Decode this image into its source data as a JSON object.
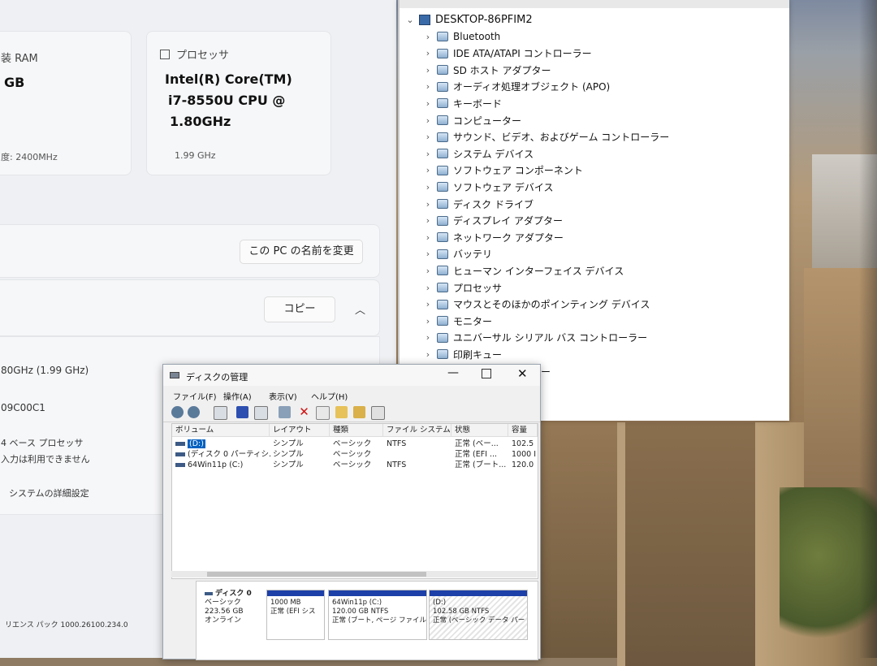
{
  "settings": {
    "ram_label_partial": "装 RAM",
    "ram_value_partial": "GB",
    "ram_speed_partial": "度: 2400MHz",
    "processor_label": "プロセッサ",
    "processor_line1": "Intel(R) Core(TM)",
    "processor_line2": "i7-8550U CPU @",
    "processor_line3": "1.80GHz",
    "processor_speed": "1.99 GHz",
    "rename_button": "この PC の名前を変更",
    "copy_button": "コピー",
    "spec_rows": [
      "80GHz (1.99 GHz)",
      "09C00C1",
      "4 ベース プロセッサ",
      "入力は利用できません"
    ],
    "advanced_link": "システムの詳細設定",
    "experience_pack": "リエンス パック 1000.26100.234.0"
  },
  "device_manager": {
    "root": "DESKTOP-86PFIM2",
    "items": [
      "Bluetooth",
      "IDE ATA/ATAPI コントローラー",
      "SD ホスト アダプター",
      "オーディオ処理オブジェクト (APO)",
      "キーボード",
      "コンピューター",
      "サウンド、ビデオ、およびゲーム コントローラー",
      "システム デバイス",
      "ソフトウェア コンポーネント",
      "ソフトウェア デバイス",
      "ディスク ドライブ",
      "ディスプレイ アダプター",
      "ネットワーク アダプター",
      "バッテリ",
      "ヒューマン インターフェイス デバイス",
      "プロセッサ",
      "マウスとそのほかのポインティング デバイス",
      "モニター",
      "ユニバーサル シリアル バス コントローラー",
      "印刷キュー",
      "記憶域コントローラー"
    ]
  },
  "disk_management": {
    "title": "ディスクの管理",
    "menu": [
      "ファイル(F)",
      "操作(A)",
      "表示(V)",
      "ヘルプ(H)"
    ],
    "columns": [
      "ボリューム",
      "レイアウト",
      "種類",
      "ファイル システム",
      "状態",
      "容量"
    ],
    "rows": [
      [
        "(D:)",
        "シンプル",
        "ベーシック",
        "NTFS",
        "正常 (ベー...",
        "102.5"
      ],
      [
        "(ディスク 0 パーティシ...",
        "シンプル",
        "ベーシック",
        "",
        "正常 (EFI ...",
        "1000 I"
      ],
      [
        "64Win11p (C:)",
        "シンプル",
        "ベーシック",
        "NTFS",
        "正常 (ブート...",
        "120.0"
      ]
    ],
    "disk": {
      "name": "ディスク 0",
      "type": "ベーシック",
      "size": "223.56 GB",
      "status": "オンライン"
    },
    "partitions": [
      {
        "name": "",
        "size": "1000 MB",
        "status": "正常 (EFI シス"
      },
      {
        "name": "64Win11p (C:)",
        "size": "120.00 GB NTFS",
        "status": "正常 (ブート, ページ ファイル"
      },
      {
        "name": "(D:)",
        "size": "102.58 GB NTFS",
        "status": "正常 (ベーシック データ パー"
      }
    ]
  }
}
